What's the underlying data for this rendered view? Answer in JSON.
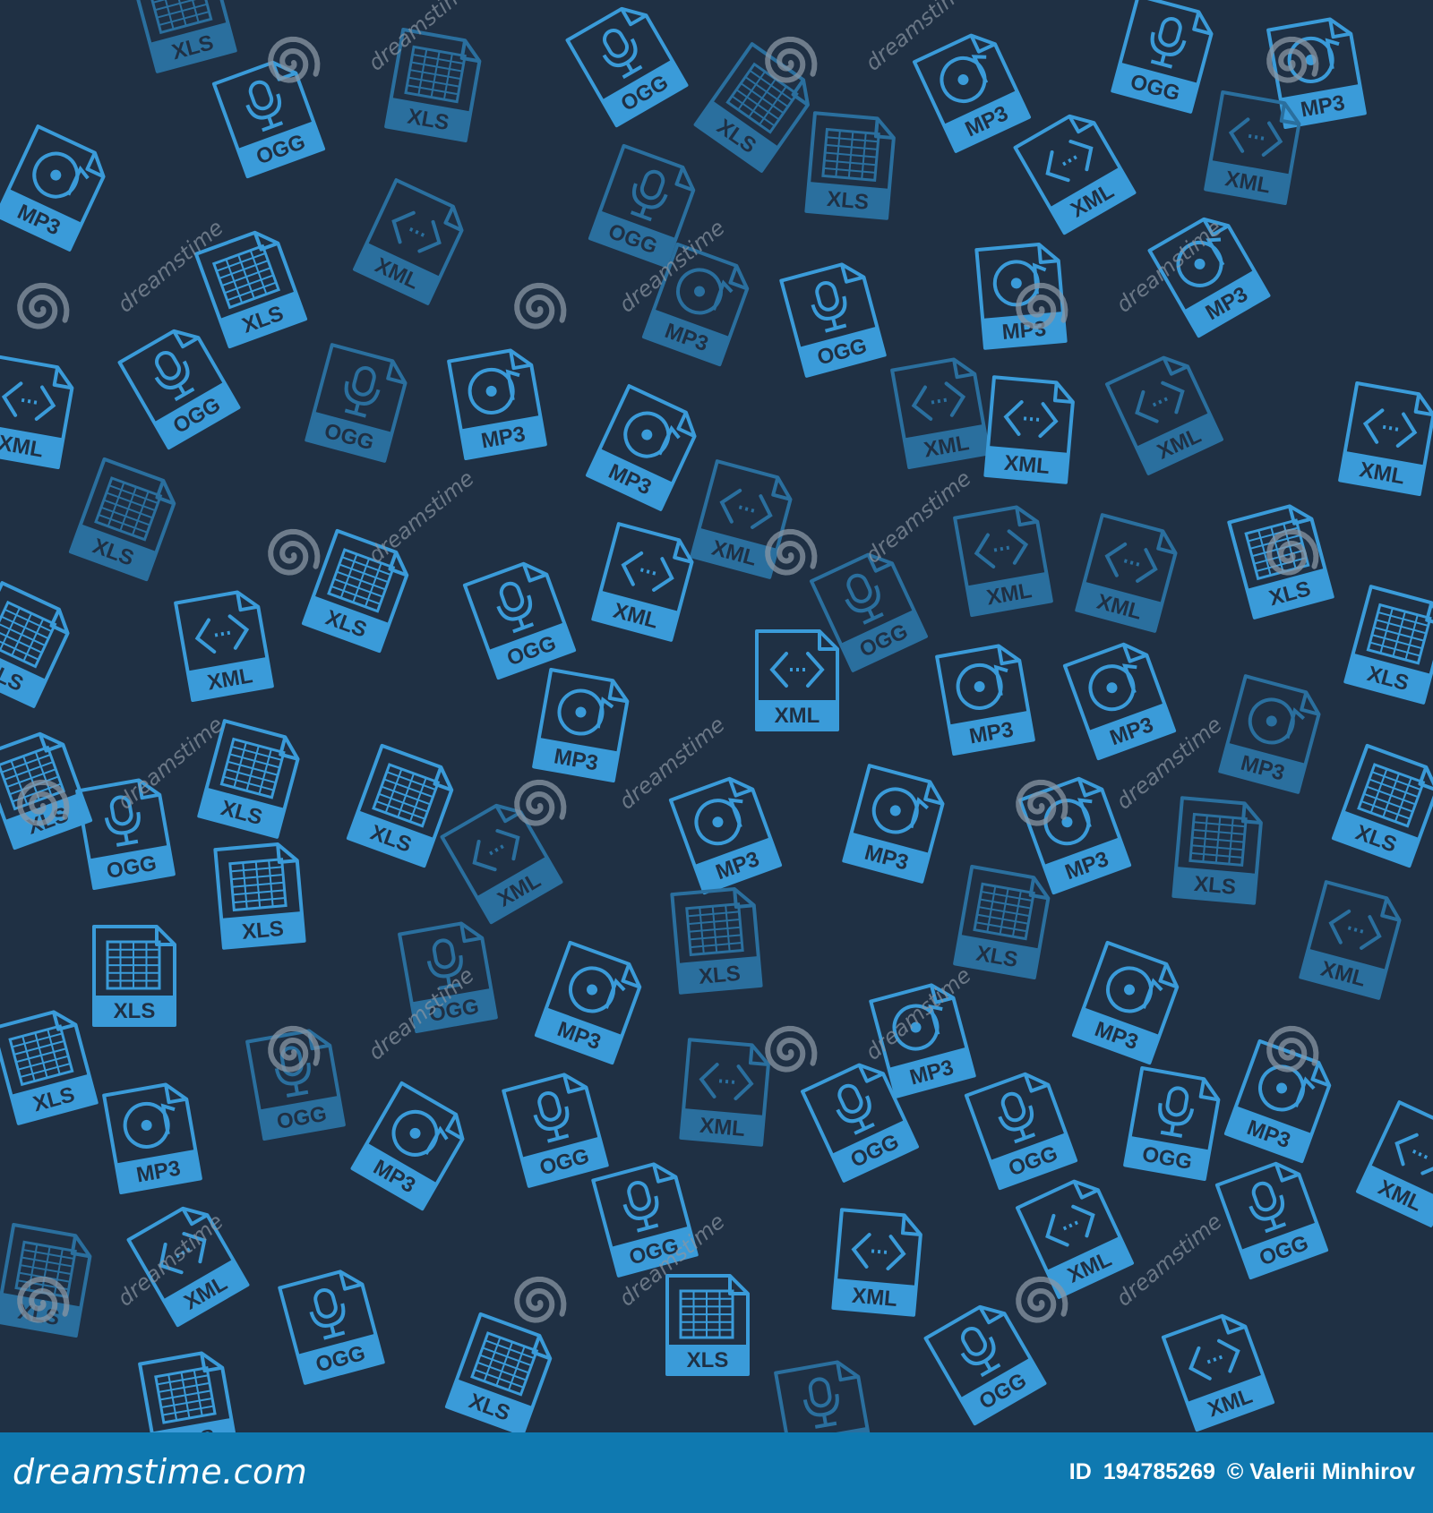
{
  "colors": {
    "background": "#1f3044",
    "icon_bright": "#3a9bd9",
    "icon_dim": "#2a6f9e",
    "watermark": "#8a95a3",
    "footer": "#0f79b0"
  },
  "icon_types": [
    "MP3",
    "OGG",
    "XLS",
    "XML"
  ],
  "watermark": {
    "text": "dreamstime",
    "icon": "dreamstime-spiral-icon"
  },
  "footer": {
    "logo": "dreamstime.com",
    "id_label": "ID",
    "id_number": "194785269",
    "credit": "© Valerii Minhirov"
  }
}
